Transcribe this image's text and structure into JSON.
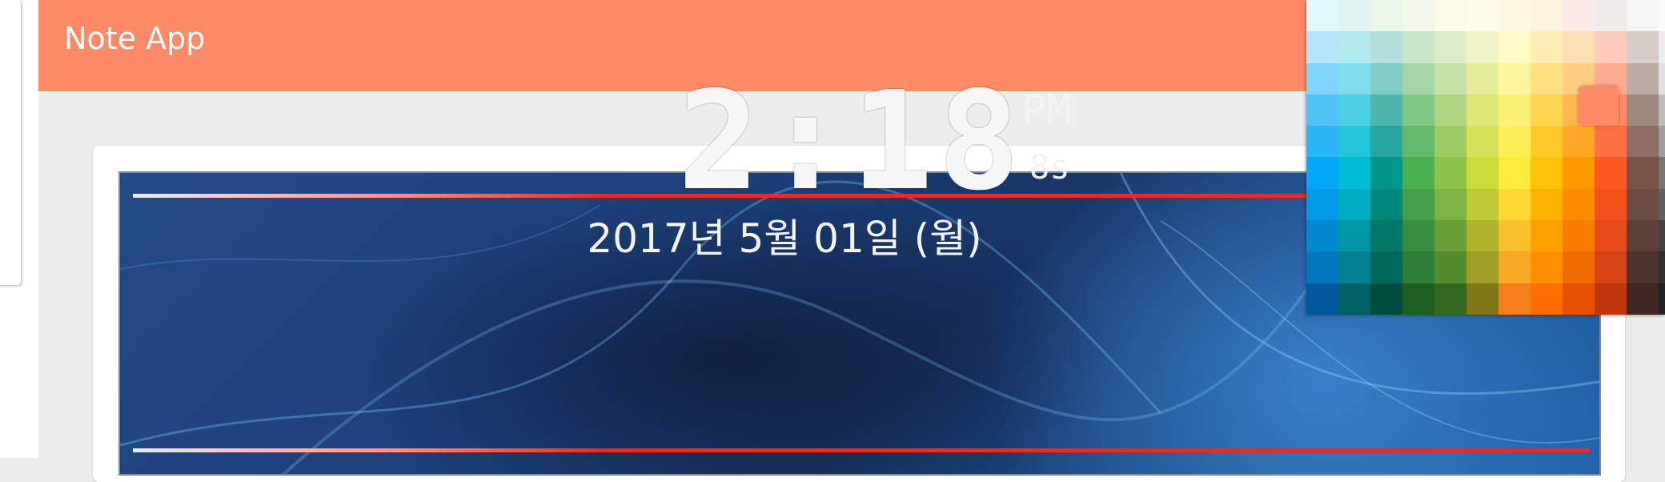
{
  "app": {
    "title": "Note App"
  },
  "clock": {
    "time": "2:18",
    "ampm": "PM",
    "seconds": "8s",
    "date": "2017년 5월 01일 (월)"
  },
  "colors": {
    "app_bar": "#ff8a65",
    "background": "#ececec",
    "stripe_red": "#e82a2a",
    "selected_swatch": "#ff8a65"
  },
  "palette": {
    "selected_color": "#ff8a65",
    "rows": [
      [
        "#e0f7fa",
        "#e0f2f1",
        "#e8f5e9",
        "#f1f8e9",
        "#f9fbe7",
        "#fffde7",
        "#fff8e1",
        "#fff3e0",
        "#fbe9e7",
        "#efebe9",
        "#f5f5f5",
        "#fafafa"
      ],
      [
        "#b3e5fc",
        "#b2ebf2",
        "#b2dfdb",
        "#c8e6c9",
        "#dcedc8",
        "#f0f4c3",
        "#fff9c4",
        "#ffecb3",
        "#ffe0b2",
        "#ffccbc",
        "#d7ccc8",
        "#eeeeee"
      ],
      [
        "#81d4fa",
        "#80deea",
        "#80cbc4",
        "#a5d6a7",
        "#c5e1a5",
        "#e6ee9c",
        "#fff59d",
        "#ffe082",
        "#ffcc80",
        "#ffab91",
        "#bcaaa4",
        "#e0e0e0"
      ],
      [
        "#4fc3f7",
        "#4dd0e1",
        "#4db6ac",
        "#81c784",
        "#aed581",
        "#dce775",
        "#fff176",
        "#ffd54f",
        "#ffb74d",
        "#ff8a65",
        "#a1887f",
        "#bdbdbd"
      ],
      [
        "#29b6f6",
        "#26c6da",
        "#26a69a",
        "#66bb6a",
        "#9ccc65",
        "#d4e157",
        "#ffee58",
        "#ffca28",
        "#ffa726",
        "#ff7043",
        "#8d6e63",
        "#9e9e9e"
      ],
      [
        "#03a9f4",
        "#00bcd4",
        "#009688",
        "#4caf50",
        "#8bc34a",
        "#cddc39",
        "#ffeb3b",
        "#ffc107",
        "#ff9800",
        "#ff5722",
        "#795548",
        "#757575"
      ],
      [
        "#039be5",
        "#00acc1",
        "#00897b",
        "#43a047",
        "#7cb342",
        "#c0ca33",
        "#fdd835",
        "#ffb300",
        "#fb8c00",
        "#f4511e",
        "#6d4c41",
        "#616161"
      ],
      [
        "#0288d1",
        "#0097a7",
        "#00796b",
        "#388e3c",
        "#689f38",
        "#afb42b",
        "#fbc02d",
        "#ffa000",
        "#f57c00",
        "#e64a19",
        "#5d4037",
        "#424242"
      ],
      [
        "#0277bd",
        "#00838f",
        "#00695c",
        "#2e7d32",
        "#558b2f",
        "#9e9d24",
        "#f9a825",
        "#ff8f00",
        "#ef6c00",
        "#d84315",
        "#4e342e",
        "#303030"
      ],
      [
        "#01579b",
        "#006064",
        "#004d40",
        "#1b5e20",
        "#33691e",
        "#827717",
        "#f57f17",
        "#ff6f00",
        "#e65100",
        "#bf360c",
        "#3e2723",
        "#212121"
      ]
    ]
  }
}
